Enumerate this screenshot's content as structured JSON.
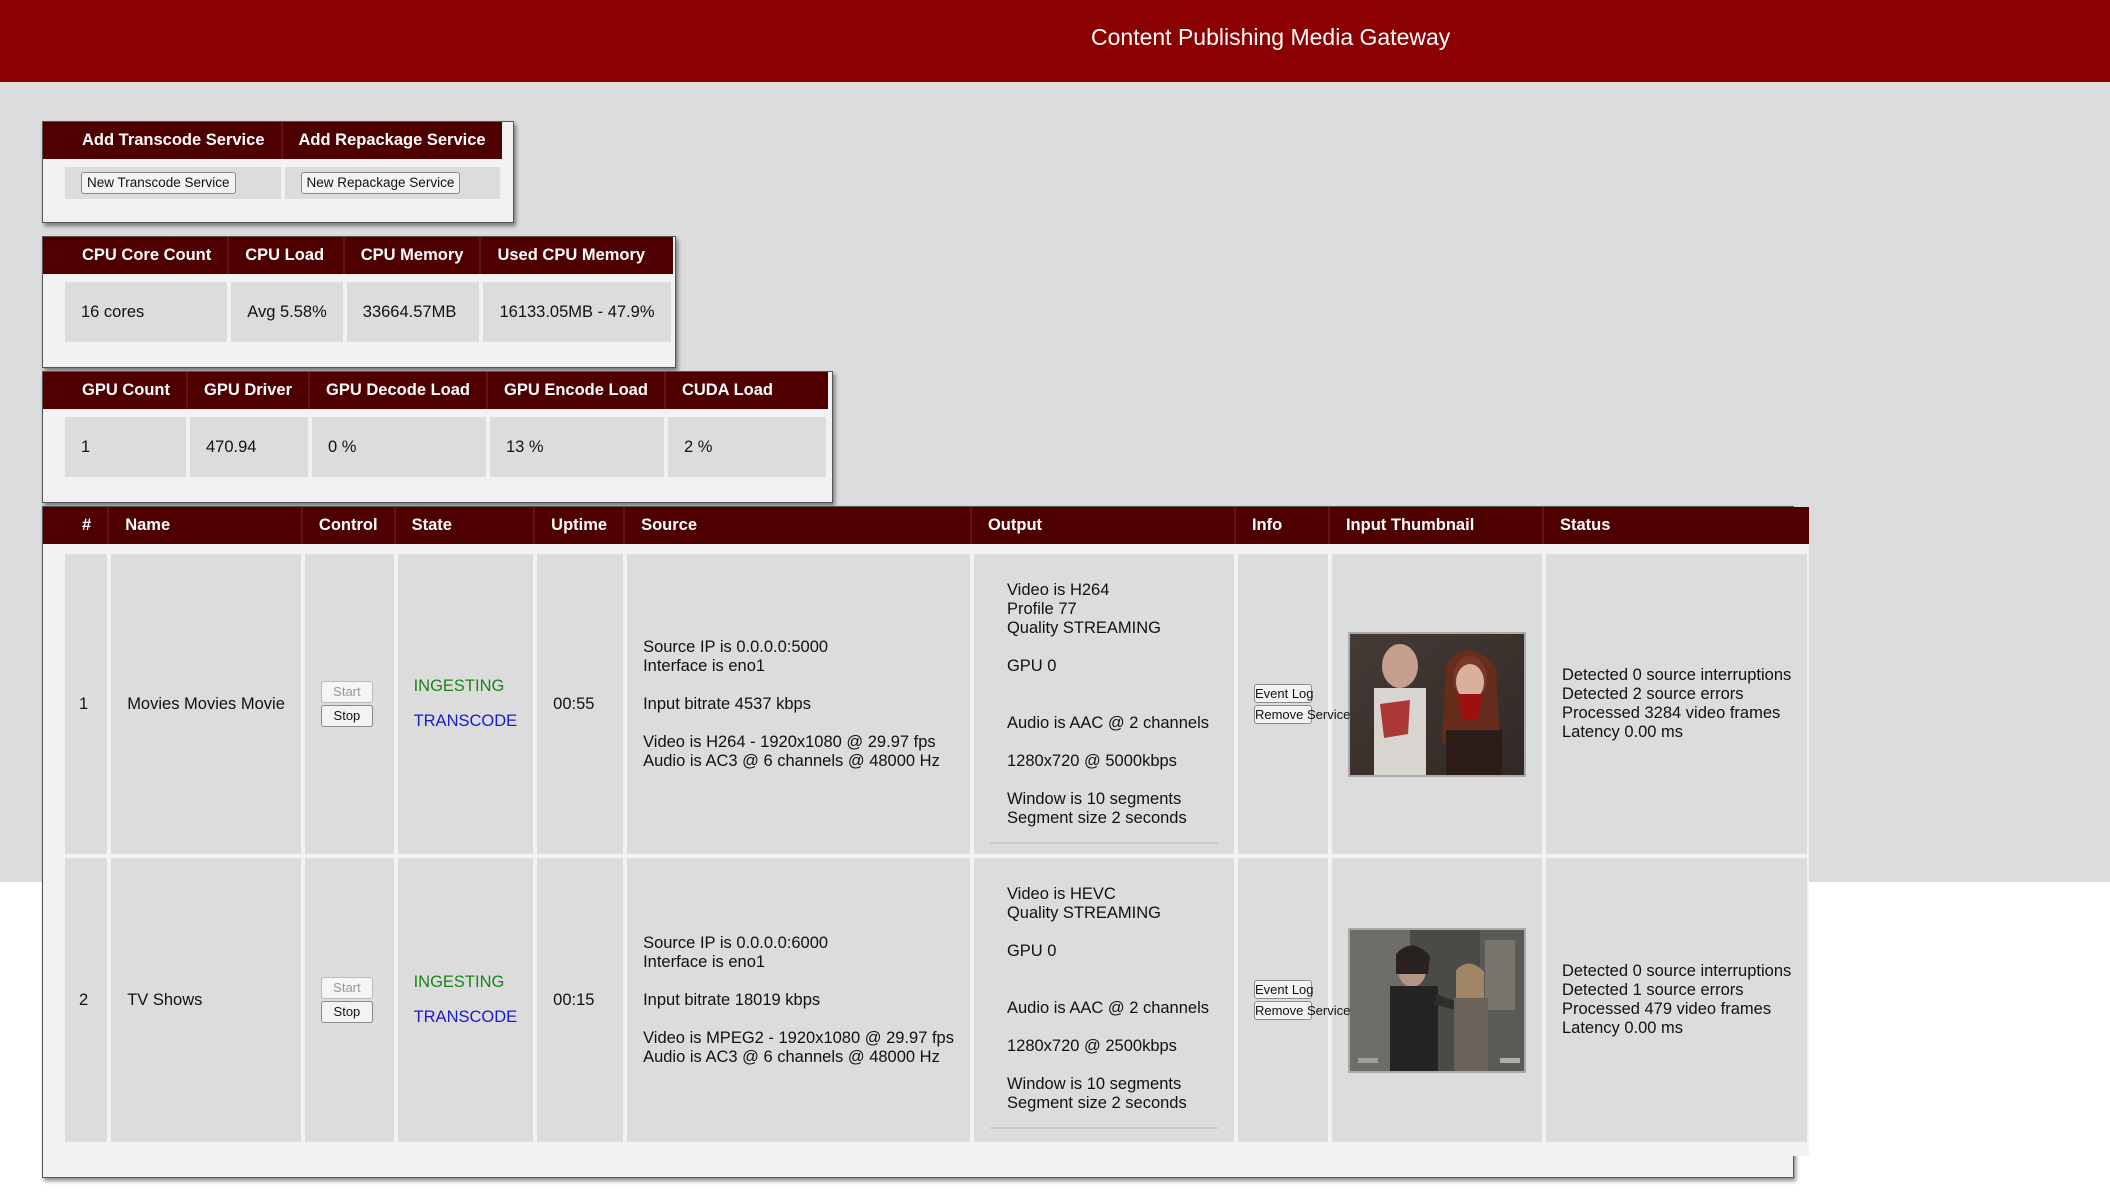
{
  "header": {
    "title": "Content Publishing Media Gateway"
  },
  "add_panel": {
    "col_transcode": "Add Transcode Service",
    "col_repackage": "Add Repackage Service",
    "btn_transcode": "New Transcode Service",
    "btn_repackage": "New Repackage Service"
  },
  "cpu": {
    "headers": [
      "CPU Core Count",
      "CPU Load",
      "CPU Memory",
      "Used CPU Memory"
    ],
    "values": [
      "16 cores",
      "Avg 5.58%",
      "33664.57MB",
      "16133.05MB - 47.9%"
    ]
  },
  "gpu": {
    "headers": [
      "GPU Count",
      "GPU Driver",
      "GPU Decode Load",
      "GPU Encode Load",
      "CUDA Load"
    ],
    "values": [
      "1",
      "470.94",
      "0 %",
      "13 %",
      "2 %"
    ]
  },
  "services": {
    "headers": [
      "#",
      "Name",
      "Control",
      "State",
      "Uptime",
      "Source",
      "Output",
      "Info",
      "Input Thumbnail",
      "Status"
    ],
    "start_label": "Start",
    "stop_label": "Stop",
    "event_log_label": "Event Log",
    "remove_label": "Remove Service",
    "rows": [
      {
        "num": "1",
        "name": "Movies Movies Movie",
        "state1": "INGESTING",
        "state2": "TRANSCODE",
        "uptime": "00:55",
        "source": {
          "ip": "Source IP is 0.0.0.0:5000",
          "iface": "Interface is eno1",
          "bitrate": "Input bitrate 4537 kbps",
          "video": "Video is H264 - 1920x1080 @ 29.97 fps",
          "audio": "Audio is AC3 @ 6 channels @ 48000 Hz"
        },
        "output": {
          "video": "Video is H264",
          "profile": "Profile 77",
          "quality": "Quality STREAMING",
          "gpu": "GPU 0",
          "audio": "Audio is AAC @ 2 channels",
          "res": "1280x720 @ 5000kbps",
          "window": "Window is 10 segments",
          "segment": "Segment size 2 seconds"
        },
        "status": {
          "interruptions": "Detected 0 source interruptions",
          "errors": "Detected 2 source errors",
          "frames": "Processed 3284 video frames",
          "latency": "Latency 0.00 ms"
        }
      },
      {
        "num": "2",
        "name": "TV Shows",
        "state1": "INGESTING",
        "state2": "TRANSCODE",
        "uptime": "00:15",
        "source": {
          "ip": "Source IP is 0.0.0.0:6000",
          "iface": "Interface is eno1",
          "bitrate": "Input bitrate 18019 kbps",
          "video": "Video is MPEG2 - 1920x1080 @ 29.97 fps",
          "audio": "Audio is AC3 @ 6 channels @ 48000 Hz"
        },
        "output": {
          "video": "Video is HEVC",
          "quality": "Quality STREAMING",
          "gpu": "GPU 0",
          "audio": "Audio is AAC @ 2 channels",
          "res": "1280x720 @ 2500kbps",
          "window": "Window is 10 segments",
          "segment": "Segment size 2 seconds"
        },
        "status": {
          "interruptions": "Detected 0 source interruptions",
          "errors": "Detected 1 source errors",
          "frames": "Processed 479 video frames",
          "latency": "Latency 0.00 ms"
        }
      }
    ]
  },
  "colors": {
    "header_red": "#8b0000",
    "table_header": "#4e0000",
    "ingesting": "#178517",
    "transcode": "#1a1acc"
  }
}
